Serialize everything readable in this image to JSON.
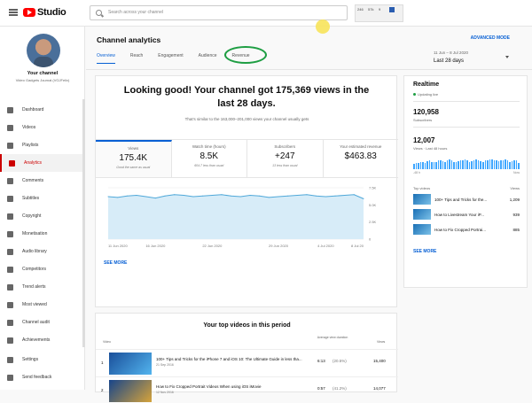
{
  "app": {
    "logo_text": "Studio",
    "search_placeholder": "Search across your channel"
  },
  "top_widget": {
    "cells": [
      "246",
      "57k",
      "9"
    ]
  },
  "sidebar": {
    "channel_title": "Your channel",
    "channel_name": "Video Gadgets Journal (VGJFelix)",
    "items": [
      {
        "label": "Dashboard"
      },
      {
        "label": "Videos"
      },
      {
        "label": "Playlists"
      },
      {
        "label": "Analytics",
        "active": true
      },
      {
        "label": "Comments"
      },
      {
        "label": "Subtitles"
      },
      {
        "label": "Copyright"
      },
      {
        "label": "Monetisation"
      },
      {
        "label": "Audio library"
      },
      {
        "label": "Competitors"
      },
      {
        "label": "Trend alerts"
      },
      {
        "label": "Most viewed"
      },
      {
        "label": "Channel audit"
      },
      {
        "label": "Achievements"
      }
    ],
    "bottom_items": [
      {
        "label": "Settings"
      },
      {
        "label": "Send feedback"
      }
    ]
  },
  "header": {
    "title": "Channel analytics",
    "tabs": [
      "Overview",
      "Reach",
      "Engagement",
      "Audience",
      "Revenue"
    ],
    "advanced_mode": "ADVANCED MODE",
    "date_range": "11 Jun – 8 Jul 2020",
    "date_label": "Last 28 days"
  },
  "overview": {
    "headline": "Looking good! Your channel got 175,369 views in the last 28 days.",
    "subline": "That's similar to the 163,000–201,000 views your channel usually gets",
    "kpis": [
      {
        "label": "Views",
        "value": "175.4K",
        "note": "Good the same as usual"
      },
      {
        "label": "Watch time (hours)",
        "value": "8.5K",
        "note": "604.7 less than usual"
      },
      {
        "label": "Subscribers",
        "value": "+247",
        "note": "13 less than usual"
      },
      {
        "label": "Your estimated revenue",
        "value": "$463.83",
        "note": ""
      }
    ],
    "see_more": "SEE MORE"
  },
  "chart_data": {
    "type": "area",
    "x": [
      "11 Jun 2020",
      "12 Jun",
      "13 Jun",
      "14 Jun",
      "15 Jun",
      "16 Jun 2020",
      "17 Jun",
      "18 Jun",
      "19 Jun",
      "20 Jun",
      "21 Jun",
      "22 Jun 2020",
      "23 Jun",
      "24 Jun",
      "25 Jun",
      "26 Jun",
      "27 Jun",
      "28 Jun",
      "29 Jun 2020",
      "30 Jun",
      "1 Jul",
      "2 Jul",
      "3 Jul",
      "4 Jul 2020",
      "5 Jul",
      "6 Jul",
      "7 Jul",
      "8 Jul 2020"
    ],
    "tick_labels": [
      "11 Jun 2020",
      "16 Jun 2020",
      "22 Jun 2020",
      "29 Jun 2020",
      "4 Jul 2020",
      "8 Jul 20"
    ],
    "tick_index": [
      0,
      5,
      11,
      18,
      23,
      27
    ],
    "values": [
      6200,
      6100,
      6300,
      6400,
      6200,
      6000,
      6300,
      6500,
      6400,
      6200,
      6300,
      6400,
      6500,
      6300,
      6200,
      6400,
      6300,
      6100,
      6200,
      6300,
      6400,
      6500,
      6300,
      6200,
      6300,
      6400,
      6500,
      5900
    ],
    "y_ticks": [
      "7.5K",
      "5.0K",
      "2.5K",
      "0"
    ],
    "ylim": [
      0,
      7500
    ],
    "grid": true
  },
  "realtime": {
    "title": "Realtime",
    "updating": "Updating live",
    "subscribers_value": "120,958",
    "subscribers_label": "Subscribers",
    "views_value": "12,007",
    "views_label": "Views · Last 48 hours",
    "axis_left": "-48 h",
    "axis_right": "Now",
    "bars": [
      0.5,
      0.6,
      0.55,
      0.7,
      0.65,
      0.6,
      0.75,
      0.8,
      0.7,
      0.65,
      0.7,
      0.8,
      0.85,
      0.75,
      0.7,
      0.8,
      0.9,
      0.85,
      0.7,
      0.65,
      0.75,
      0.8,
      0.85,
      0.9,
      0.8,
      0.7,
      0.75,
      0.85,
      0.9,
      0.8,
      0.75,
      0.7,
      0.8,
      0.85,
      0.9,
      0.95,
      0.85,
      0.8,
      0.75,
      0.8,
      0.85,
      0.9,
      0.8,
      0.7,
      0.75,
      0.8,
      0.85,
      0.6
    ],
    "top_videos_label": "Top videos",
    "views_col_label": "Views",
    "videos": [
      {
        "title": "100+ Tips and Tricks for the...",
        "views": "1,209"
      },
      {
        "title": "How to Livestream Your iP...",
        "views": "939"
      },
      {
        "title": "How to Fix Cropped Portrai...",
        "views": "885"
      }
    ],
    "see_more": "SEE MORE"
  },
  "top_videos": {
    "title": "Your top videos in this period",
    "col_video": "Video",
    "col_avg": "Average view duration",
    "col_views": "Views",
    "rows": [
      {
        "rank": "1",
        "title": "100+ Tips and Tricks for the iPhone 7 and iOS 10: The Ultimate Guide in less tha...",
        "date": "21 Sep 2016",
        "avg": "6:13",
        "pct": "(20.5%)",
        "views": "15,400"
      },
      {
        "rank": "2",
        "title": "How to Fix Cropped Portrait Videos When using iOS iMovie",
        "date": "12 Nov 2016",
        "avg": "0:57",
        "pct": "(41.2%)",
        "views": "14,077"
      }
    ]
  }
}
